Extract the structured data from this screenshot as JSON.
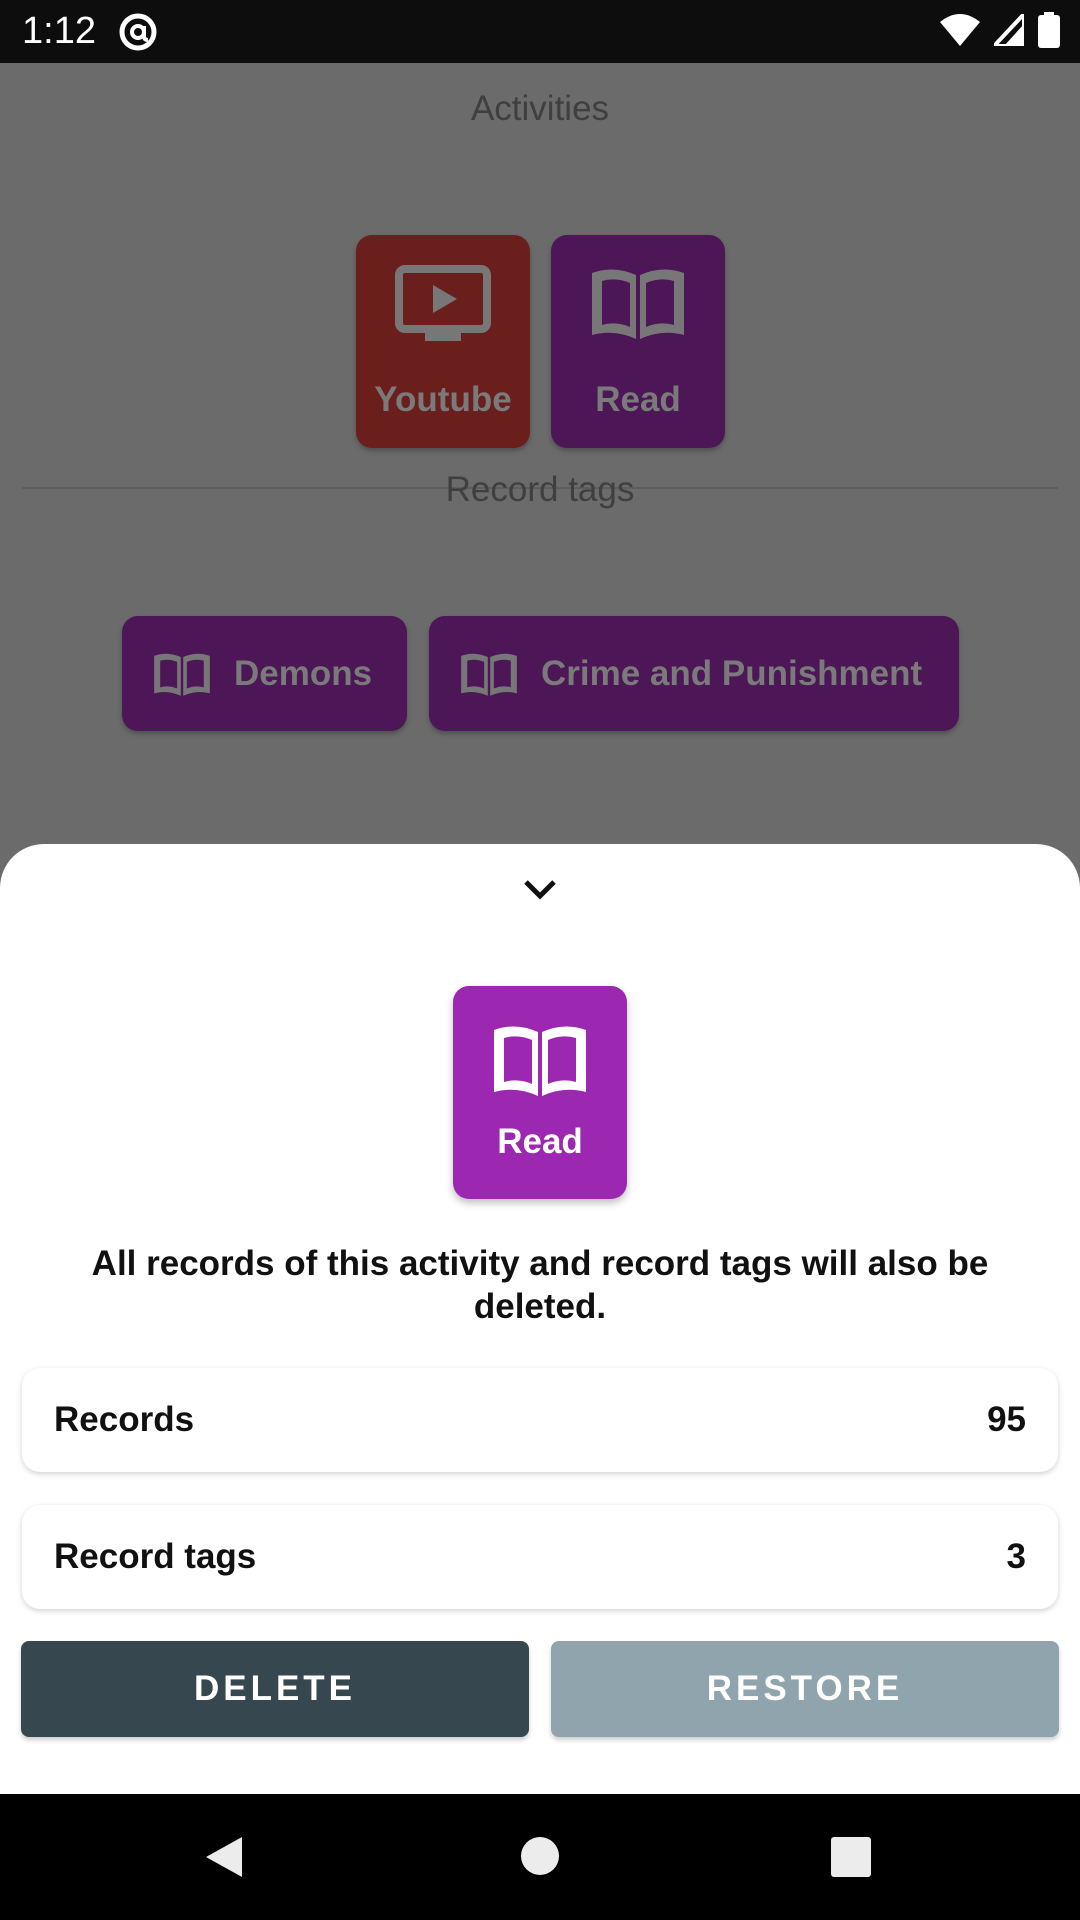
{
  "status_bar": {
    "time": "1:12"
  },
  "background": {
    "activities_title": "Activities",
    "activities": [
      {
        "label": "Youtube",
        "icon": "tv-play-icon",
        "color": "#6b1f1c"
      },
      {
        "label": "Read",
        "icon": "book-open-icon",
        "color": "#4d1657"
      }
    ],
    "record_tags_title": "Record tags",
    "record_tags": [
      {
        "label": "Demons",
        "icon": "book-open-icon"
      },
      {
        "label": "Crime and Punishment",
        "icon": "book-open-icon"
      }
    ]
  },
  "sheet": {
    "activity": {
      "label": "Read",
      "icon": "book-open-icon",
      "color": "#9c27b0"
    },
    "warning": "All records of this activity and record tags will also be deleted.",
    "stats": [
      {
        "label": "Records",
        "value": "95"
      },
      {
        "label": "Record tags",
        "value": "3"
      }
    ],
    "delete_label": "DELETE",
    "restore_label": "RESTORE",
    "delete_color": "#37474f",
    "restore_color": "#90a4ae"
  }
}
